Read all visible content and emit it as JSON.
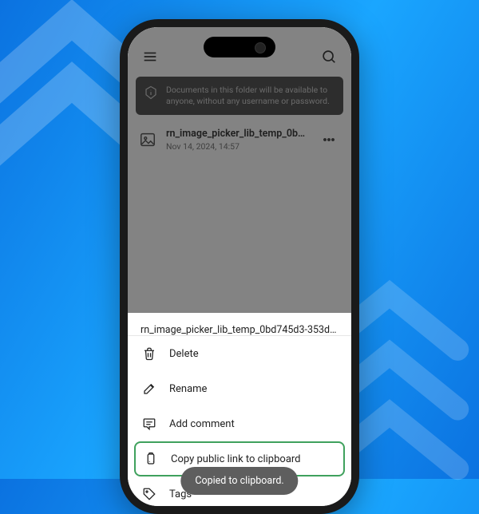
{
  "banner": {
    "text": "Documents in this folder will be available to anyone, without any username or password."
  },
  "file": {
    "name_truncated": "rn_image_picker_lib_temp_0bd7…",
    "date": "Nov 14, 2024, 14:57"
  },
  "sheet": {
    "title": "rn_image_picker_lib_temp_0bd745d3-353d-46…",
    "items": {
      "delete": "Delete",
      "rename": "Rename",
      "add_comment": "Add comment",
      "copy_link": "Copy public link to clipboard",
      "tags": "Tags"
    }
  },
  "toast": {
    "text": "Copied to clipboard."
  }
}
